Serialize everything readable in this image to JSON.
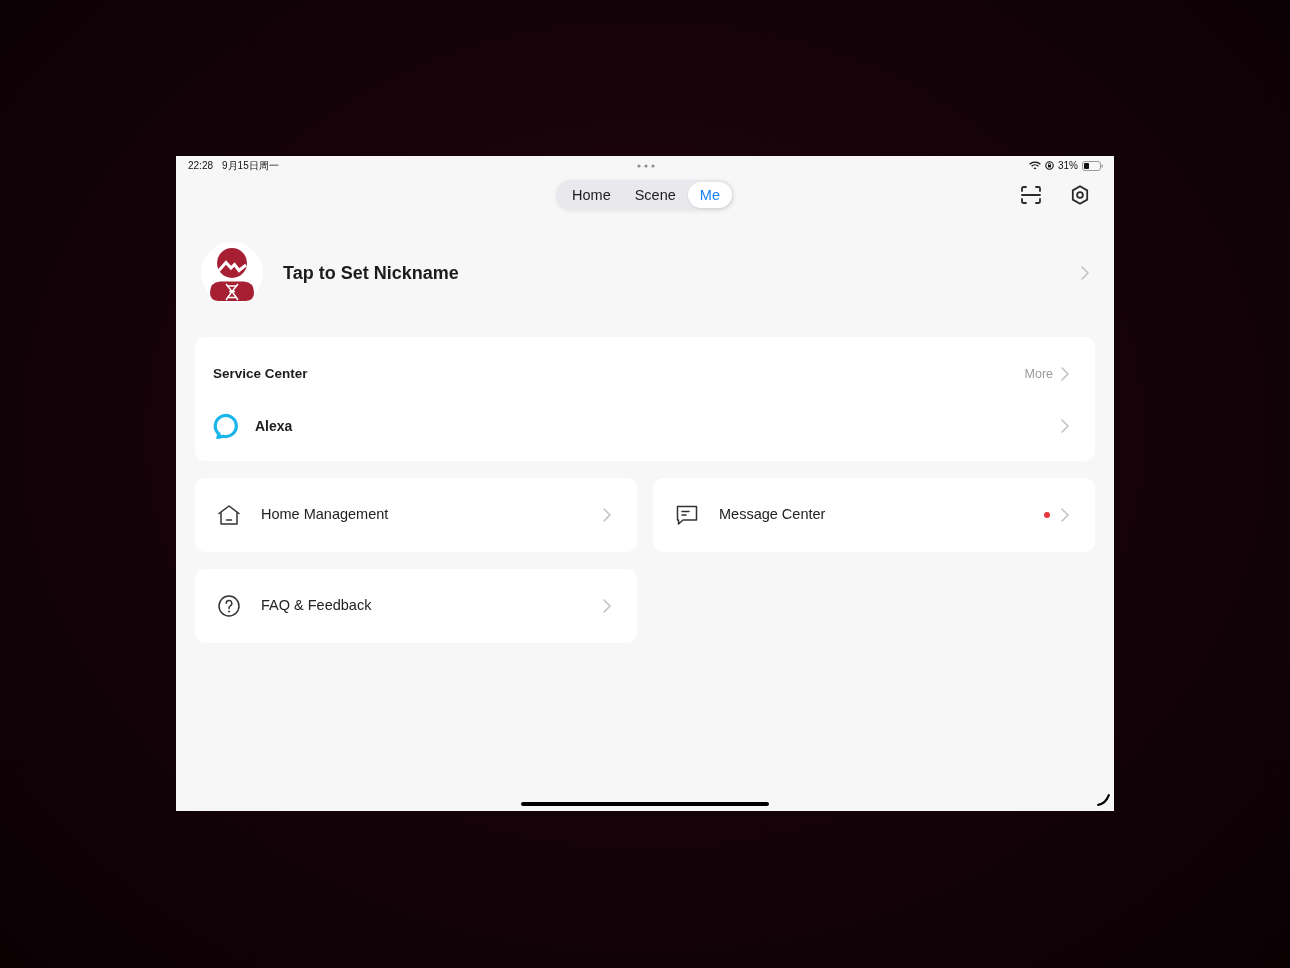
{
  "status_bar": {
    "time": "22:28",
    "date": "9月15日周一",
    "battery_text": "31%"
  },
  "tabs": [
    {
      "label": "Home",
      "selected": false
    },
    {
      "label": "Scene",
      "selected": false
    },
    {
      "label": "Me",
      "selected": true
    }
  ],
  "profile": {
    "nickname": "Tap to Set Nickname"
  },
  "service_center": {
    "title": "Service Center",
    "more": "More",
    "items": [
      {
        "label": "Alexa"
      }
    ]
  },
  "menu": [
    {
      "label": "Home Management",
      "kind": "home",
      "unread": false
    },
    {
      "label": "Message Center",
      "kind": "message",
      "unread": true
    },
    {
      "label": "FAQ & Feedback",
      "kind": "faq",
      "unread": false
    }
  ]
}
